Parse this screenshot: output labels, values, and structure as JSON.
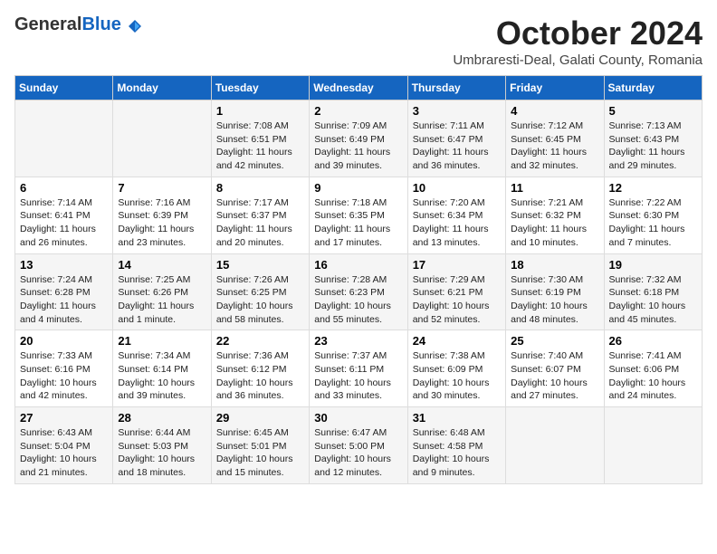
{
  "header": {
    "logo_general": "General",
    "logo_blue": "Blue",
    "month_title": "October 2024",
    "location": "Umbraresti-Deal, Galati County, Romania"
  },
  "weekdays": [
    "Sunday",
    "Monday",
    "Tuesday",
    "Wednesday",
    "Thursday",
    "Friday",
    "Saturday"
  ],
  "weeks": [
    [
      {
        "day": "",
        "sunrise": "",
        "sunset": "",
        "daylight": ""
      },
      {
        "day": "",
        "sunrise": "",
        "sunset": "",
        "daylight": ""
      },
      {
        "day": "1",
        "sunrise": "Sunrise: 7:08 AM",
        "sunset": "Sunset: 6:51 PM",
        "daylight": "Daylight: 11 hours and 42 minutes."
      },
      {
        "day": "2",
        "sunrise": "Sunrise: 7:09 AM",
        "sunset": "Sunset: 6:49 PM",
        "daylight": "Daylight: 11 hours and 39 minutes."
      },
      {
        "day": "3",
        "sunrise": "Sunrise: 7:11 AM",
        "sunset": "Sunset: 6:47 PM",
        "daylight": "Daylight: 11 hours and 36 minutes."
      },
      {
        "day": "4",
        "sunrise": "Sunrise: 7:12 AM",
        "sunset": "Sunset: 6:45 PM",
        "daylight": "Daylight: 11 hours and 32 minutes."
      },
      {
        "day": "5",
        "sunrise": "Sunrise: 7:13 AM",
        "sunset": "Sunset: 6:43 PM",
        "daylight": "Daylight: 11 hours and 29 minutes."
      }
    ],
    [
      {
        "day": "6",
        "sunrise": "Sunrise: 7:14 AM",
        "sunset": "Sunset: 6:41 PM",
        "daylight": "Daylight: 11 hours and 26 minutes."
      },
      {
        "day": "7",
        "sunrise": "Sunrise: 7:16 AM",
        "sunset": "Sunset: 6:39 PM",
        "daylight": "Daylight: 11 hours and 23 minutes."
      },
      {
        "day": "8",
        "sunrise": "Sunrise: 7:17 AM",
        "sunset": "Sunset: 6:37 PM",
        "daylight": "Daylight: 11 hours and 20 minutes."
      },
      {
        "day": "9",
        "sunrise": "Sunrise: 7:18 AM",
        "sunset": "Sunset: 6:35 PM",
        "daylight": "Daylight: 11 hours and 17 minutes."
      },
      {
        "day": "10",
        "sunrise": "Sunrise: 7:20 AM",
        "sunset": "Sunset: 6:34 PM",
        "daylight": "Daylight: 11 hours and 13 minutes."
      },
      {
        "day": "11",
        "sunrise": "Sunrise: 7:21 AM",
        "sunset": "Sunset: 6:32 PM",
        "daylight": "Daylight: 11 hours and 10 minutes."
      },
      {
        "day": "12",
        "sunrise": "Sunrise: 7:22 AM",
        "sunset": "Sunset: 6:30 PM",
        "daylight": "Daylight: 11 hours and 7 minutes."
      }
    ],
    [
      {
        "day": "13",
        "sunrise": "Sunrise: 7:24 AM",
        "sunset": "Sunset: 6:28 PM",
        "daylight": "Daylight: 11 hours and 4 minutes."
      },
      {
        "day": "14",
        "sunrise": "Sunrise: 7:25 AM",
        "sunset": "Sunset: 6:26 PM",
        "daylight": "Daylight: 11 hours and 1 minute."
      },
      {
        "day": "15",
        "sunrise": "Sunrise: 7:26 AM",
        "sunset": "Sunset: 6:25 PM",
        "daylight": "Daylight: 10 hours and 58 minutes."
      },
      {
        "day": "16",
        "sunrise": "Sunrise: 7:28 AM",
        "sunset": "Sunset: 6:23 PM",
        "daylight": "Daylight: 10 hours and 55 minutes."
      },
      {
        "day": "17",
        "sunrise": "Sunrise: 7:29 AM",
        "sunset": "Sunset: 6:21 PM",
        "daylight": "Daylight: 10 hours and 52 minutes."
      },
      {
        "day": "18",
        "sunrise": "Sunrise: 7:30 AM",
        "sunset": "Sunset: 6:19 PM",
        "daylight": "Daylight: 10 hours and 48 minutes."
      },
      {
        "day": "19",
        "sunrise": "Sunrise: 7:32 AM",
        "sunset": "Sunset: 6:18 PM",
        "daylight": "Daylight: 10 hours and 45 minutes."
      }
    ],
    [
      {
        "day": "20",
        "sunrise": "Sunrise: 7:33 AM",
        "sunset": "Sunset: 6:16 PM",
        "daylight": "Daylight: 10 hours and 42 minutes."
      },
      {
        "day": "21",
        "sunrise": "Sunrise: 7:34 AM",
        "sunset": "Sunset: 6:14 PM",
        "daylight": "Daylight: 10 hours and 39 minutes."
      },
      {
        "day": "22",
        "sunrise": "Sunrise: 7:36 AM",
        "sunset": "Sunset: 6:12 PM",
        "daylight": "Daylight: 10 hours and 36 minutes."
      },
      {
        "day": "23",
        "sunrise": "Sunrise: 7:37 AM",
        "sunset": "Sunset: 6:11 PM",
        "daylight": "Daylight: 10 hours and 33 minutes."
      },
      {
        "day": "24",
        "sunrise": "Sunrise: 7:38 AM",
        "sunset": "Sunset: 6:09 PM",
        "daylight": "Daylight: 10 hours and 30 minutes."
      },
      {
        "day": "25",
        "sunrise": "Sunrise: 7:40 AM",
        "sunset": "Sunset: 6:07 PM",
        "daylight": "Daylight: 10 hours and 27 minutes."
      },
      {
        "day": "26",
        "sunrise": "Sunrise: 7:41 AM",
        "sunset": "Sunset: 6:06 PM",
        "daylight": "Daylight: 10 hours and 24 minutes."
      }
    ],
    [
      {
        "day": "27",
        "sunrise": "Sunrise: 6:43 AM",
        "sunset": "Sunset: 5:04 PM",
        "daylight": "Daylight: 10 hours and 21 minutes."
      },
      {
        "day": "28",
        "sunrise": "Sunrise: 6:44 AM",
        "sunset": "Sunset: 5:03 PM",
        "daylight": "Daylight: 10 hours and 18 minutes."
      },
      {
        "day": "29",
        "sunrise": "Sunrise: 6:45 AM",
        "sunset": "Sunset: 5:01 PM",
        "daylight": "Daylight: 10 hours and 15 minutes."
      },
      {
        "day": "30",
        "sunrise": "Sunrise: 6:47 AM",
        "sunset": "Sunset: 5:00 PM",
        "daylight": "Daylight: 10 hours and 12 minutes."
      },
      {
        "day": "31",
        "sunrise": "Sunrise: 6:48 AM",
        "sunset": "Sunset: 4:58 PM",
        "daylight": "Daylight: 10 hours and 9 minutes."
      },
      {
        "day": "",
        "sunrise": "",
        "sunset": "",
        "daylight": ""
      },
      {
        "day": "",
        "sunrise": "",
        "sunset": "",
        "daylight": ""
      }
    ]
  ]
}
